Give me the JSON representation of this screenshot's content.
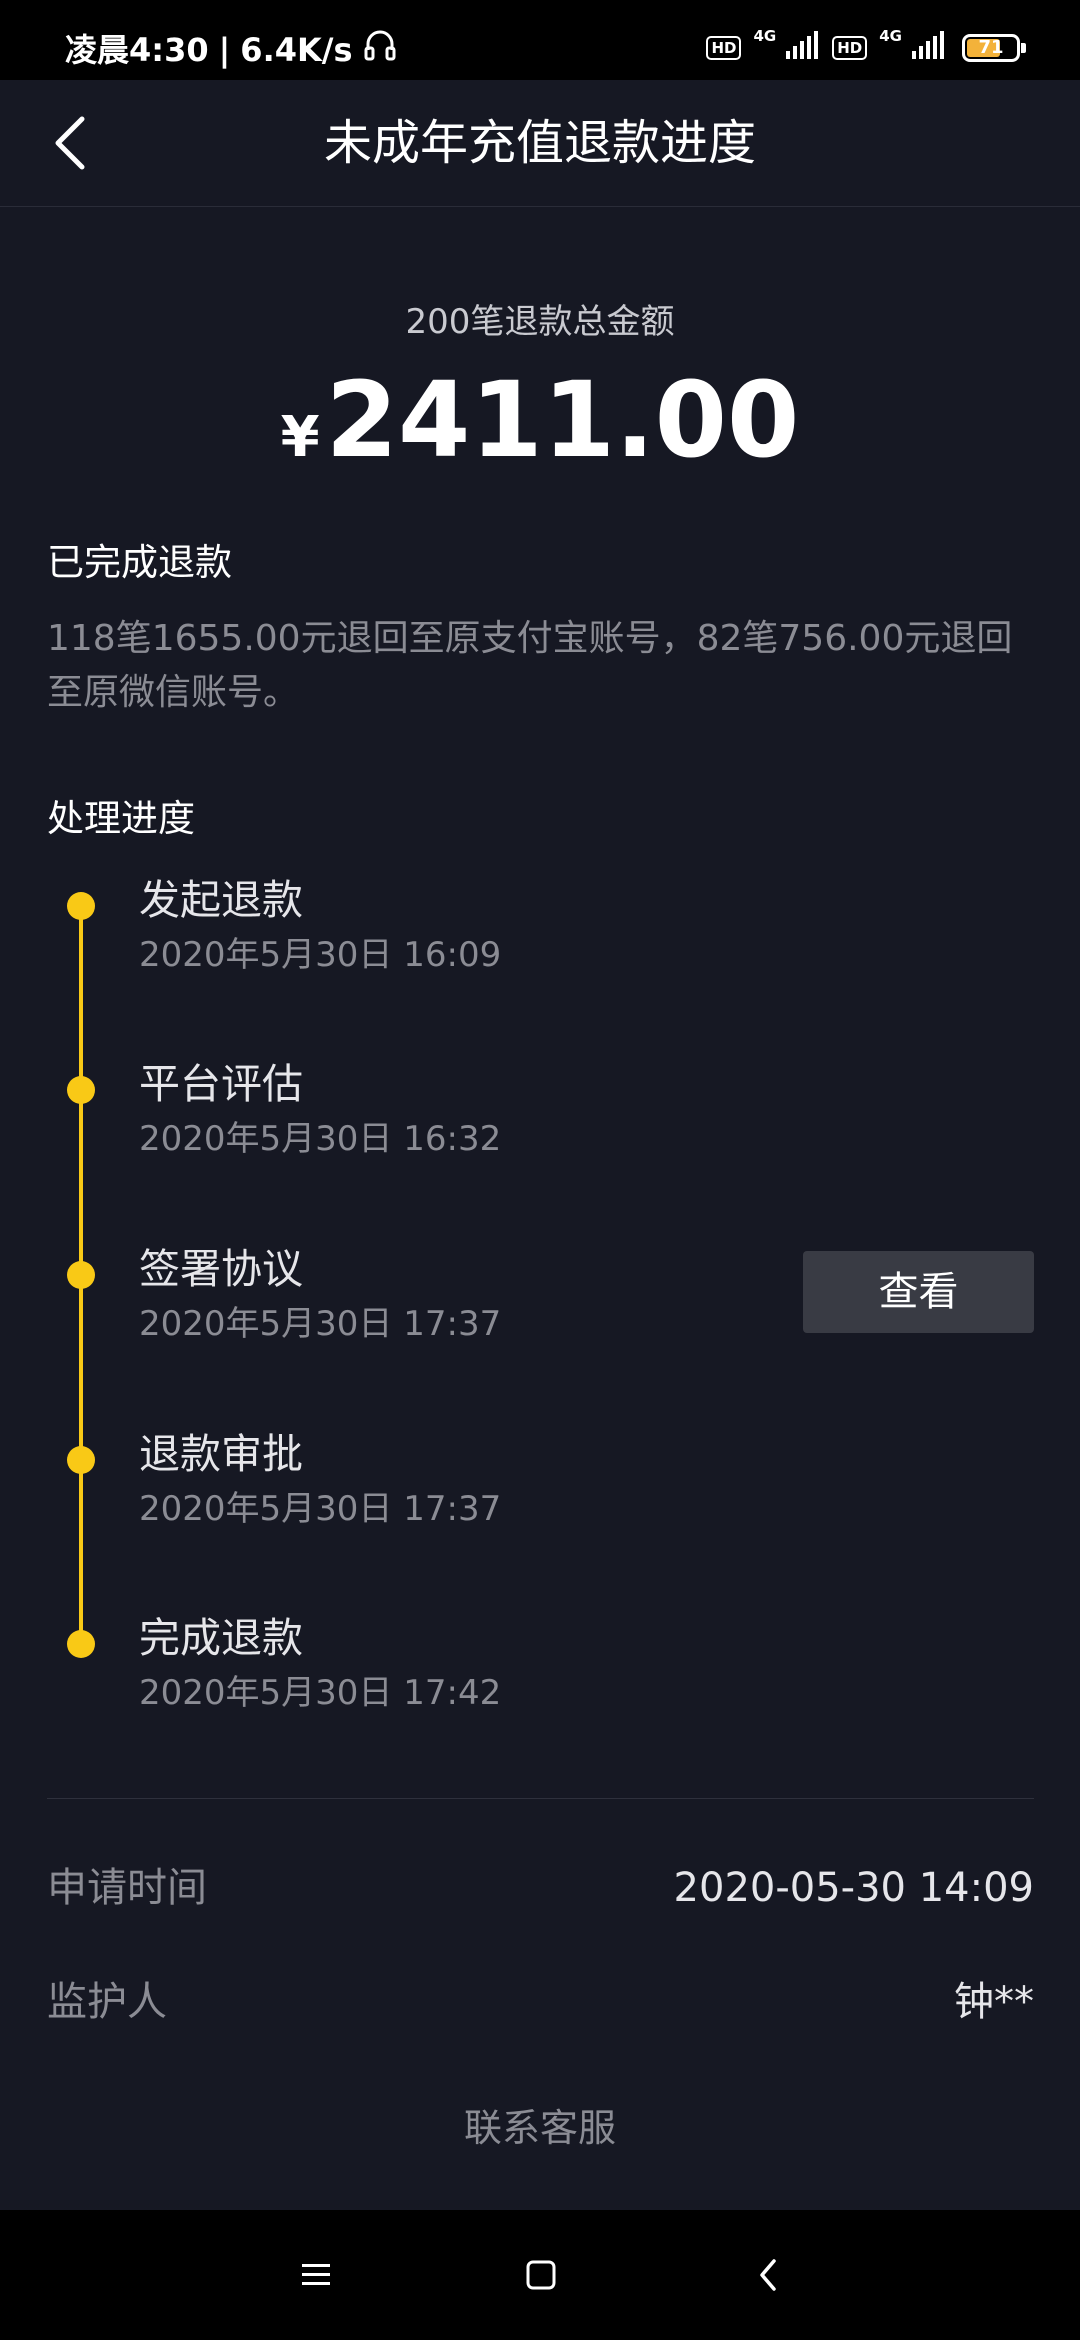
{
  "status_bar": {
    "time": "凌晨4:30",
    "speed": "6.4K/s",
    "hd1": "HD",
    "net1": "4G",
    "hd2": "HD",
    "net2": "4G",
    "battery_level": 71,
    "battery_text": "71",
    "battery_color": "#f3b23a"
  },
  "header": {
    "title": "未成年充值退款进度"
  },
  "summary": {
    "label": "200笔退款总金额",
    "currency": "¥",
    "amount": "2411.00"
  },
  "completed": {
    "title": "已完成退款",
    "description": "118笔1655.00元退回至原支付宝账号，82笔756.00元退回至原微信账号。"
  },
  "progress": {
    "title": "处理进度",
    "accent_color": "#f9c916",
    "steps": [
      {
        "name": "发起退款",
        "time": "2020年5月30日 16:09"
      },
      {
        "name": "平台评估",
        "time": "2020年5月30日 16:32"
      },
      {
        "name": "签署协议",
        "time": "2020年5月30日 17:37"
      },
      {
        "name": "退款审批",
        "time": "2020年5月30日 17:37"
      },
      {
        "name": "完成退款",
        "time": "2020年5月30日 17:42"
      }
    ],
    "view_button": "查看"
  },
  "info": {
    "apply_time_label": "申请时间",
    "apply_time_value": "2020-05-30 14:09",
    "guardian_label": "监护人",
    "guardian_value": "钟**"
  },
  "contact": {
    "label": "联系客服"
  },
  "icons": {
    "back": "chevron-left-icon",
    "headset": "headset-icon",
    "menu": "menu-icon",
    "home": "home-square-icon",
    "nav_back": "nav-back-icon"
  }
}
